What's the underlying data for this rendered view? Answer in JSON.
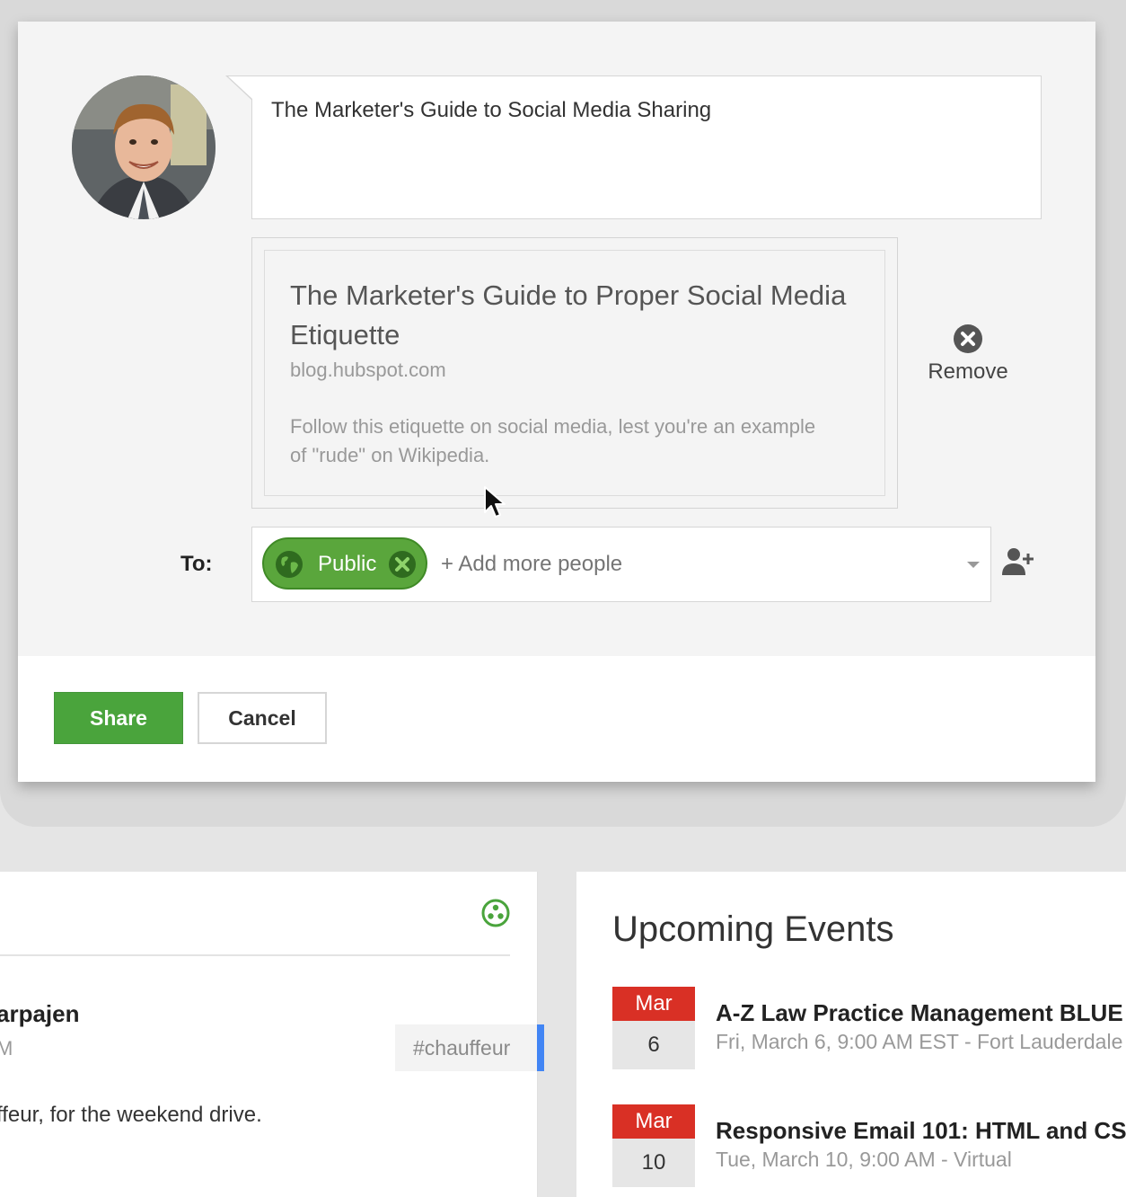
{
  "share_dialog": {
    "message": "The Marketer's Guide to Social Media Sharing",
    "link_preview": {
      "title": "The Marketer's Guide to Proper Social Media Etiquette",
      "domain": "blog.hubspot.com",
      "description": "Follow this etiquette on social media, lest you're an example of \"rude\" on Wikipedia."
    },
    "remove_label": "Remove",
    "to_label": "To:",
    "audience_chip": "Public",
    "add_people_placeholder": "+ Add more people",
    "share_button": "Share",
    "cancel_button": "Cancel"
  },
  "left_card": {
    "author_fragment": "arpajen",
    "time_fragment": "M",
    "hashtag": "#chauffeur",
    "post_text_fragment": "ffeur, for the weekend drive."
  },
  "events": {
    "heading": "Upcoming Events",
    "items": [
      {
        "month": "Mar",
        "day": "6",
        "title": "A-Z Law Practice Management BLUE",
        "subtitle": "Fri, March 6, 9:00 AM EST - Fort Lauderdale"
      },
      {
        "month": "Mar",
        "day": "10",
        "title": "Responsive Email 101: HTML and CS",
        "subtitle": "Tue, March 10, 9:00 AM - Virtual"
      }
    ]
  },
  "colors": {
    "accent_green": "#4aa43c",
    "chip_green": "#5aa63c",
    "event_red": "#d93025",
    "hashtag_blue": "#4285f4"
  },
  "icons": [
    "remove-icon",
    "globe-icon",
    "close-icon",
    "chevron-down-icon",
    "add-person-icon",
    "circles-icon",
    "cursor-icon"
  ]
}
